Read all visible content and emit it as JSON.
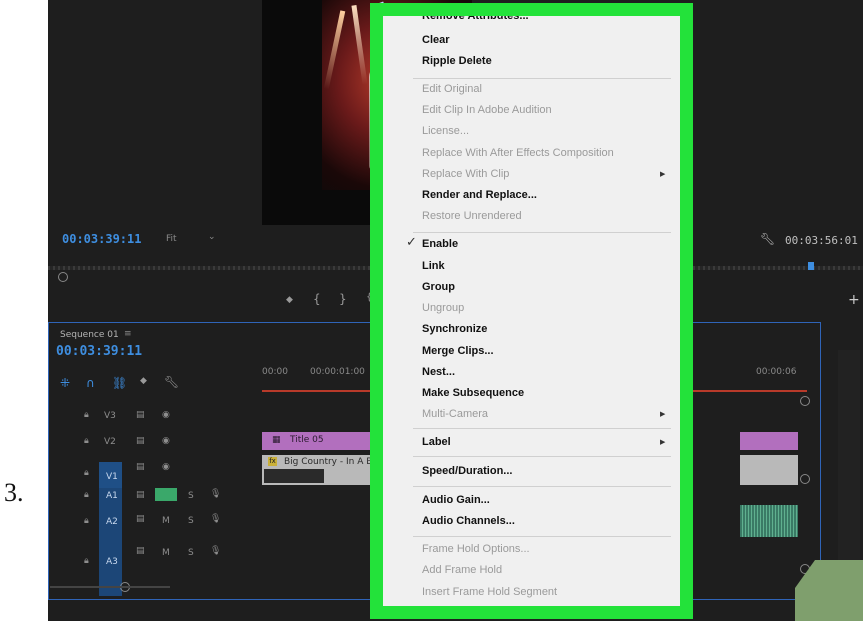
{
  "step_number": "3.",
  "monitor": {
    "timecode_left": "00:03:39:11",
    "fit_label": "Fit",
    "timecode_right": "00:03:56:01"
  },
  "sequence": {
    "tab_label": "Sequence 01",
    "timecode": "00:03:39:11",
    "ruler": [
      "00:00",
      "00:00:01:00",
      "00:00:06"
    ],
    "tracks": [
      "V3",
      "V2",
      "V1",
      "A1",
      "A2",
      "A3"
    ],
    "clip_title": "Title 05",
    "clip_video": "Big Country - In A Big Cou"
  },
  "context_menu": {
    "items": [
      {
        "label": "Remove Attributes...",
        "enabled": true
      },
      {
        "label": "Clear",
        "enabled": true
      },
      {
        "label": "Ripple Delete",
        "enabled": true
      },
      {
        "label": "Edit Original",
        "enabled": false
      },
      {
        "label": "Edit Clip In Adobe Audition",
        "enabled": false
      },
      {
        "label": "License...",
        "enabled": false
      },
      {
        "label": "Replace With After Effects Composition",
        "enabled": false
      },
      {
        "label": "Replace With Clip",
        "enabled": false
      },
      {
        "label": "Render and Replace...",
        "enabled": true
      },
      {
        "label": "Restore Unrendered",
        "enabled": false
      },
      {
        "label": "Enable",
        "enabled": true
      },
      {
        "label": "Link",
        "enabled": true
      },
      {
        "label": "Group",
        "enabled": true
      },
      {
        "label": "Ungroup",
        "enabled": false
      },
      {
        "label": "Synchronize",
        "enabled": true
      },
      {
        "label": "Merge Clips...",
        "enabled": true
      },
      {
        "label": "Nest...",
        "enabled": true
      },
      {
        "label": "Make Subsequence",
        "enabled": true
      },
      {
        "label": "Multi-Camera",
        "enabled": false
      },
      {
        "label": "Label",
        "enabled": true
      },
      {
        "label": "Speed/Duration...",
        "enabled": true
      },
      {
        "label": "Audio Gain...",
        "enabled": true
      },
      {
        "label": "Audio Channels...",
        "enabled": true
      },
      {
        "label": "Frame Hold Options...",
        "enabled": false
      },
      {
        "label": "Add Frame Hold",
        "enabled": false
      },
      {
        "label": "Insert Frame Hold Segment",
        "enabled": false
      }
    ],
    "highlight_color": "#23e23a"
  }
}
